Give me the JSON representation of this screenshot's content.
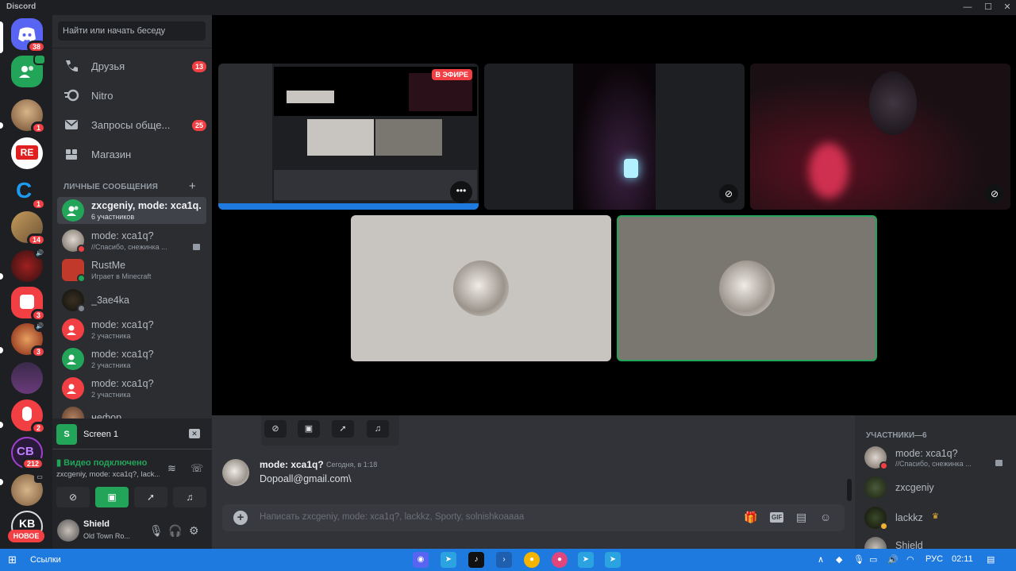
{
  "app_title": "Discord",
  "search": {
    "placeholder": "Найти или начать беседу"
  },
  "servers": [
    {
      "badge": "38"
    },
    {
      "badge": ""
    },
    {
      "badge": "1"
    },
    {
      "badge": ""
    },
    {
      "badge": "1"
    },
    {
      "badge": "14"
    },
    {
      "badge": ""
    },
    {
      "badge": "3"
    },
    {
      "badge": "3"
    },
    {
      "badge": ""
    },
    {
      "badge": "2"
    },
    {
      "badge": "212"
    },
    {
      "badge": ""
    },
    {
      "badge": "НОВОЕ"
    }
  ],
  "nav": {
    "friends": {
      "label": "Друзья",
      "count": "13"
    },
    "nitro": {
      "label": "Nitro"
    },
    "requests": {
      "label": "Запросы обще...",
      "count": "25"
    },
    "shop": {
      "label": "Магазин"
    }
  },
  "dm_header": "ЛИЧНЫЕ СООБЩЕНИЯ",
  "dms": [
    {
      "name": "zxcgeniy, mode: xca1q...",
      "sub": "6 участников"
    },
    {
      "name": "mode: xca1q?",
      "sub": "//Спасибо, снежинка ..."
    },
    {
      "name": "RustMe",
      "sub": "Играет в Minecraft"
    },
    {
      "name": "_3ae4ka",
      "sub": ""
    },
    {
      "name": "mode: xca1q?",
      "sub": "2 участника"
    },
    {
      "name": "mode: xca1q?",
      "sub": "2 участника"
    },
    {
      "name": "mode: xca1q?",
      "sub": "2 участника"
    },
    {
      "name": "нефор",
      "sub": ""
    }
  ],
  "rtc": {
    "screen_label": "Screen 1",
    "status": "Видео подключено",
    "channel": "zxcgeniy, mode: xca1q?, lack..."
  },
  "user": {
    "name": "Shield",
    "status": "Old Town Ro..."
  },
  "stream": {
    "live_label": "В ЭФИРЕ"
  },
  "message": {
    "author": "mode: xca1q?",
    "time": "Сегодня, в 1:18",
    "text": "Dopoall@gmail.com\\"
  },
  "composer": {
    "placeholder": "Написать zxcgeniy, mode: xca1q?, lackkz, Sporty, solnishkoaaaa",
    "gif": "GIF"
  },
  "members": {
    "header": "УЧАСТНИКИ—6",
    "list": [
      {
        "name": "mode: xca1q?",
        "sub": "//Спасибо, снежинка ..."
      },
      {
        "name": "zxcgeniy",
        "sub": ""
      },
      {
        "name": "lackkz",
        "sub": ""
      },
      {
        "name": "Shield",
        "sub": ""
      }
    ]
  },
  "taskbar": {
    "links": "Ссылки",
    "lang": "РУС",
    "time": "02:11"
  },
  "colors": {
    "accent_green": "#23a559",
    "badge_red": "#f23f43",
    "blurple": "#5865f2"
  }
}
